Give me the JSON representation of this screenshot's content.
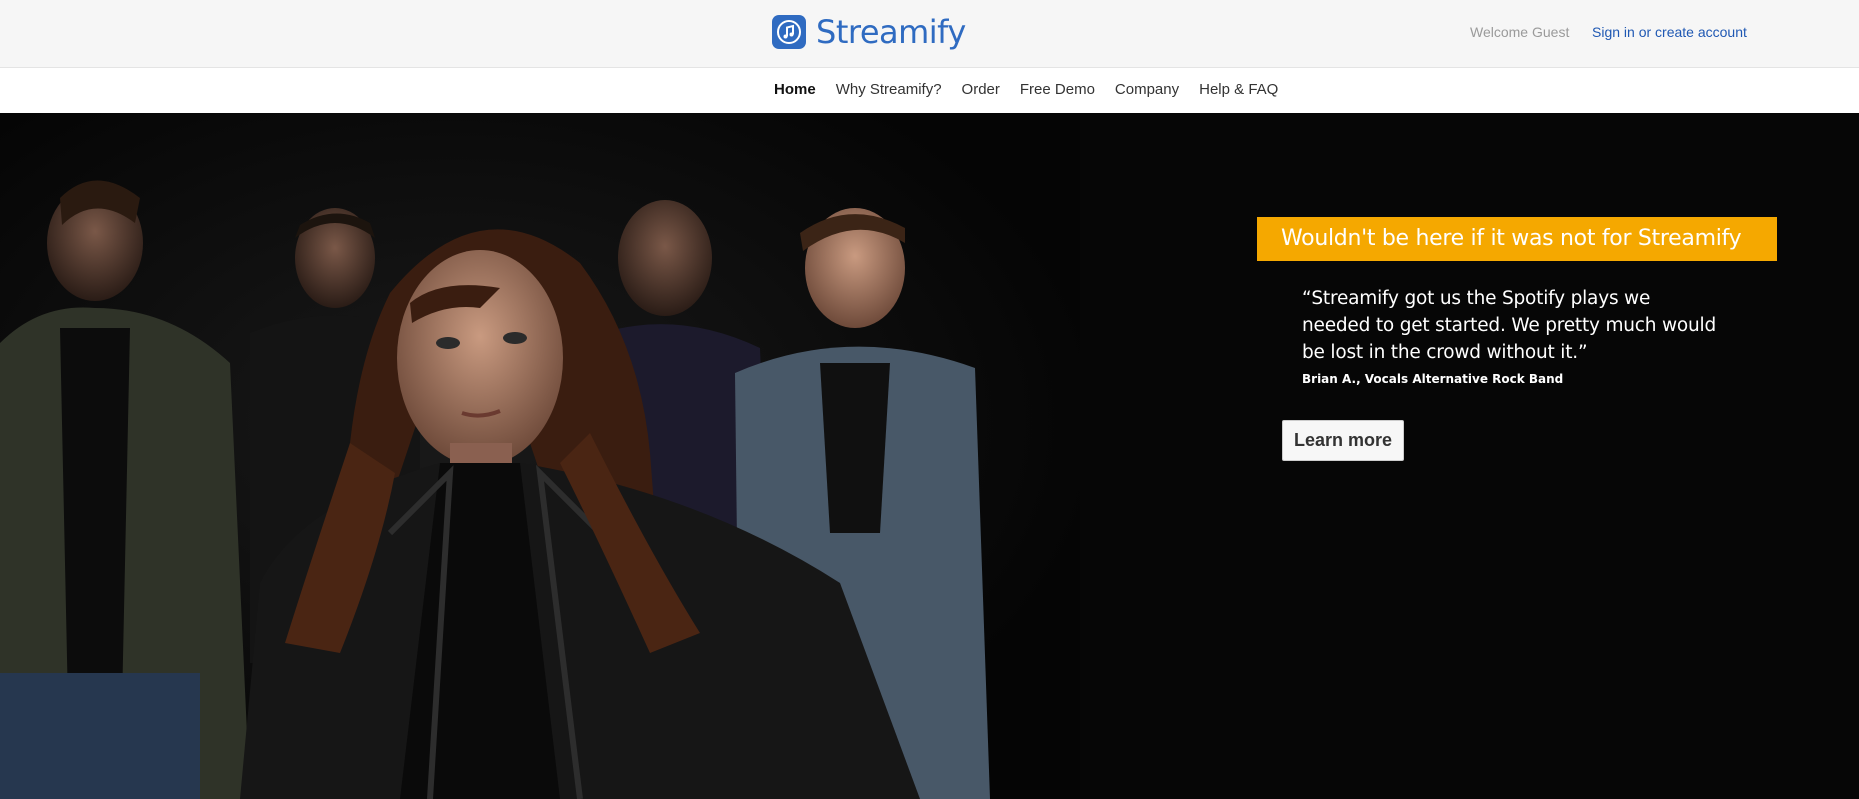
{
  "brand": {
    "name": "Streamify",
    "color": "#2f6bc1",
    "icon": "music-note-icon"
  },
  "header": {
    "welcome": "Welcome Guest",
    "signin": "Sign in or create account"
  },
  "nav": {
    "items": [
      {
        "label": "Home",
        "active": true
      },
      {
        "label": "Why Streamify?"
      },
      {
        "label": "Order"
      },
      {
        "label": "Free Demo"
      },
      {
        "label": "Company"
      },
      {
        "label": "Help & FAQ"
      }
    ]
  },
  "hero": {
    "banner_title": "Wouldn't be here if it was not for Streamify",
    "quote": "“Streamify got us the Spotify plays we needed to get started. We pretty much would be lost in the crowd without it.”",
    "author": "Brian A., Vocals Alternative Rock Band",
    "cta": "Learn more",
    "accent_color": "#f5a800"
  }
}
